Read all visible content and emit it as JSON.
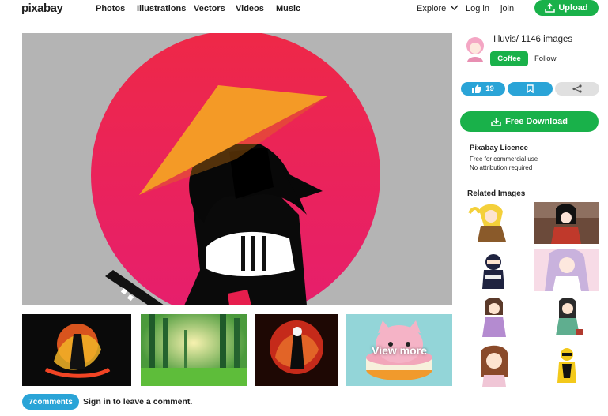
{
  "header": {
    "logo": "pixabay",
    "nav": [
      "Photos",
      "Illustrations",
      "Vectors",
      "Videos",
      "Music"
    ],
    "explore": "Explore",
    "login": "Log in",
    "join": "join",
    "upload": "Upload"
  },
  "author": {
    "name": "Illuvis",
    "separator": "/",
    "images": "1146 images",
    "coffee": "Coffee",
    "follow": "Follow"
  },
  "actions": {
    "likes": "19"
  },
  "download": "Free Download",
  "licence": {
    "title": "Pixabay Licence",
    "line1": "Free for commercial use",
    "line2": "No attribution required"
  },
  "related": {
    "title": "Related Images"
  },
  "thumbnails": {
    "view_more": "View more"
  },
  "comments": {
    "button": "7comments",
    "signin": "Sign in to leave a comment."
  },
  "colors": {
    "brand_green": "#19b14a",
    "accent_blue": "#2aa4d7",
    "sun_red": "#ea2450",
    "hat_orange": "#f49a26"
  }
}
